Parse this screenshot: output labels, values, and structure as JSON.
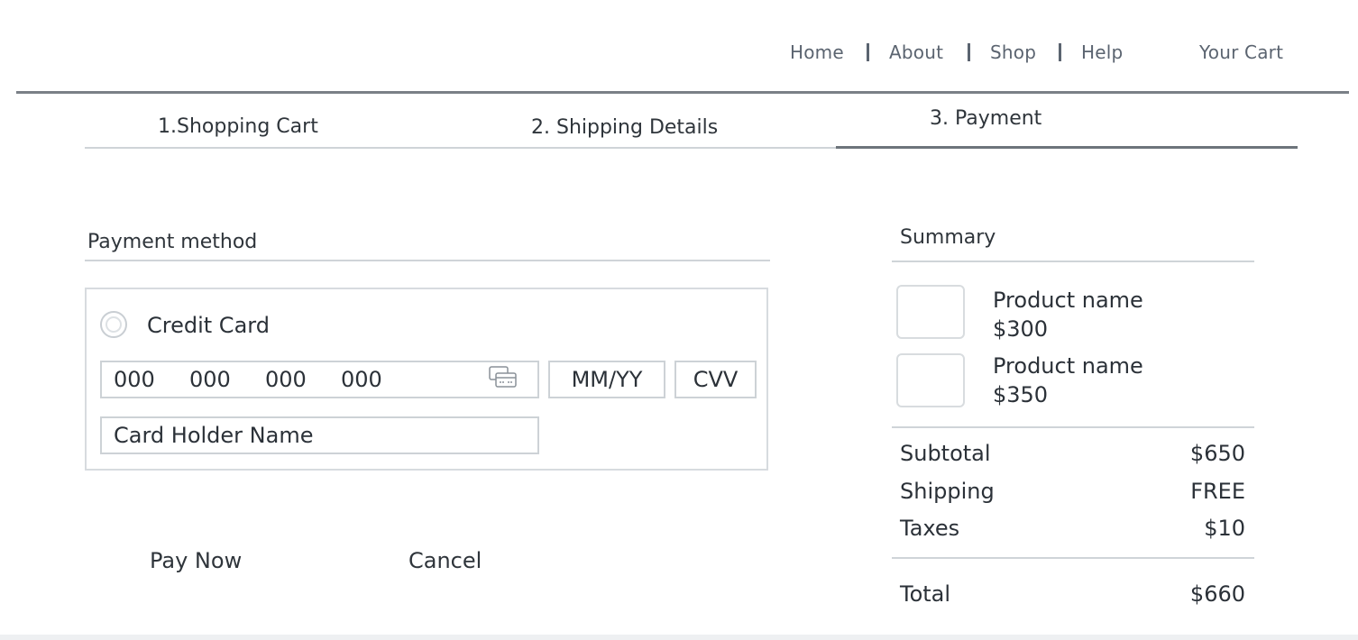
{
  "nav": {
    "links": [
      "Home",
      "About",
      "Shop",
      "Help"
    ],
    "cart": "Your Cart"
  },
  "steps": {
    "step1": "1.Shopping Cart",
    "step2": "2. Shipping Details",
    "step3": "3. Payment",
    "active": 3
  },
  "payment": {
    "title": "Payment method",
    "method_label": "Credit Card",
    "card_number": [
      "000",
      "000",
      "000",
      "000"
    ],
    "expiry_placeholder": "MM/YY",
    "cvv_placeholder": "CVV",
    "holder_placeholder": "Card Holder Name",
    "card_icon": "credit-card-icon"
  },
  "actions": {
    "pay": "Pay Now",
    "cancel": "Cancel"
  },
  "summary": {
    "title": "Summary",
    "items": [
      {
        "name": "Product name",
        "price": "$300"
      },
      {
        "name": "Product name",
        "price": "$350"
      }
    ],
    "subtotal_label": "Subtotal",
    "subtotal_value": "$650",
    "shipping_label": "Shipping",
    "shipping_value": "FREE",
    "taxes_label": "Taxes",
    "taxes_value": "$10",
    "total_label": "Total",
    "total_value": "$660"
  }
}
